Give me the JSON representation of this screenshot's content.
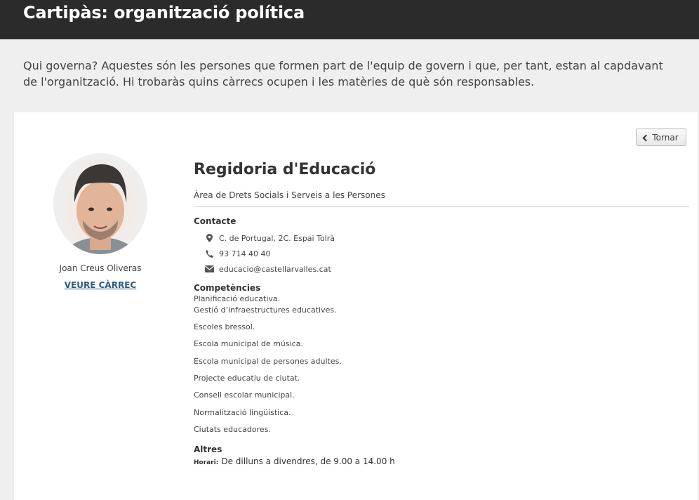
{
  "header": {
    "title": "Cartipàs: organització política"
  },
  "intro": "Qui governa? Aquestes són les persones que formen part de l'equip de govern i que, per tant, estan al capdavant de l'organització. Hi trobaràs quins càrrecs ocupen i les matèries de què són responsables.",
  "back_button": {
    "label": "Tornar",
    "icon": "chevron-left-icon"
  },
  "person": {
    "name": "Joan Creus Oliveras",
    "link_label": "VEURE CÀRREC"
  },
  "office": {
    "title": "Regidoria d'Educació",
    "area": "Àrea de Drets Socials i Serveis a les Persones"
  },
  "contact": {
    "heading": "Contacte",
    "address": "C. de Portugal, 2C. Espai Tolrà",
    "phone": "93 714 40 40",
    "email": "educacio@castellarvalles.cat"
  },
  "competencies": {
    "heading": "Competències",
    "items": [
      "Planificació educativa.",
      "Gestió d’infraestructures educatives.",
      "Escoles bressol.",
      "Escola municipal de música.",
      "Escola municipal de persones adultes.",
      "Projecte educatiu de ciutat.",
      "Consell escolar municipal.",
      "Normalització lingüística.",
      "Ciutats educadores."
    ]
  },
  "others": {
    "heading": "Altres",
    "schedule_label": "Horari:",
    "schedule_value": "De dilluns a divendres, de 9.00 a 14.00 h"
  }
}
